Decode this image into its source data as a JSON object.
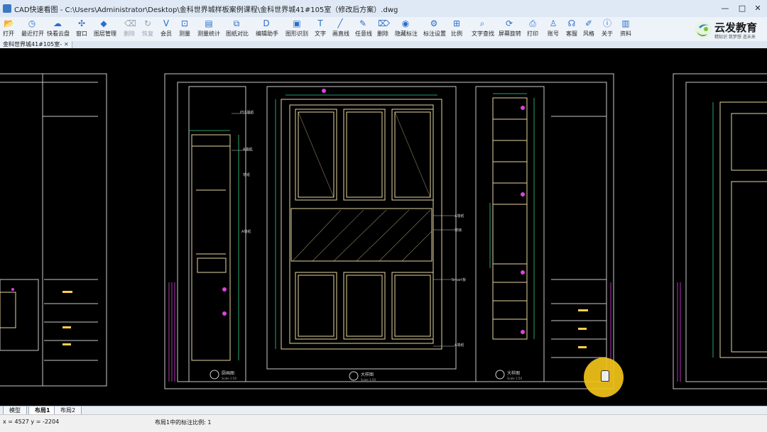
{
  "window": {
    "title": "CAD快速看图 - C:\\Users\\Administrator\\Desktop\\金科世界城样板案例课程\\金科世界城41#105室（修改后方案）.dwg",
    "minimize": "—",
    "maximize": "□",
    "close": "✕"
  },
  "toolbar": {
    "items": [
      {
        "label": "打开",
        "icon": "folder-icon",
        "glyph": "📂"
      },
      {
        "label": "最近打开",
        "icon": "clock-icon",
        "glyph": "◷"
      },
      {
        "label": "快看云盘",
        "icon": "cloud-icon",
        "glyph": "☁"
      },
      {
        "label": "窗口",
        "icon": "window-icon",
        "glyph": "✣"
      },
      {
        "label": "图层管理",
        "icon": "layers-icon",
        "glyph": "◆"
      },
      {
        "label": "删除",
        "icon": "delete-icon",
        "glyph": "⌫",
        "disabled": true
      },
      {
        "label": "恢复",
        "icon": "restore-icon",
        "glyph": "↻",
        "disabled": true
      },
      {
        "label": "会员",
        "icon": "vip-icon",
        "glyph": "V"
      },
      {
        "label": "测量",
        "icon": "ruler-icon",
        "glyph": "⊡"
      },
      {
        "label": "测量统计",
        "icon": "measure-stats-icon",
        "glyph": "▤"
      },
      {
        "label": "图纸对比",
        "icon": "compare-icon",
        "glyph": "⧉"
      },
      {
        "label": "编辑助手",
        "icon": "edit-assistant-icon",
        "glyph": "D"
      },
      {
        "label": "图形识别",
        "icon": "shape-recognition-icon",
        "glyph": "▣"
      },
      {
        "label": "文字",
        "icon": "text-icon",
        "glyph": "T"
      },
      {
        "label": "画直线",
        "icon": "line-icon",
        "glyph": "╱"
      },
      {
        "label": "任意线",
        "icon": "pencil-icon",
        "glyph": "✎"
      },
      {
        "label": "删除",
        "icon": "eraser-icon",
        "glyph": "⌦"
      },
      {
        "label": "隐藏标注",
        "icon": "hide-annotation-icon",
        "glyph": "◉"
      },
      {
        "label": "标注设置",
        "icon": "annotation-settings-icon",
        "glyph": "⚙"
      },
      {
        "label": "比例",
        "icon": "scale-icon",
        "glyph": "⊞"
      },
      {
        "label": "文字查找",
        "icon": "text-search-icon",
        "glyph": "⌕"
      },
      {
        "label": "屏幕旋转",
        "icon": "rotate-screen-icon",
        "glyph": "⟳"
      },
      {
        "label": "打印",
        "icon": "print-icon",
        "glyph": "⎙"
      },
      {
        "label": "账号",
        "icon": "account-icon",
        "glyph": "♙"
      },
      {
        "label": "客服",
        "icon": "headset-icon",
        "glyph": "☊"
      },
      {
        "label": "风格",
        "icon": "style-icon",
        "glyph": "✐"
      },
      {
        "label": "关于",
        "icon": "info-icon",
        "glyph": "ⓘ"
      },
      {
        "label": "资料",
        "icon": "book-icon",
        "glyph": "▥"
      }
    ]
  },
  "logo": {
    "name": "云发教育",
    "slogan": "精知识 筑梦想 造未来"
  },
  "document_tab": {
    "label": "金科世界城41#105室-",
    "close": "✕"
  },
  "drawing": {
    "views": [
      {
        "label": "厨画图",
        "scale": "Scale 1:50"
      },
      {
        "label": "大样图",
        "scale": "Scale 1:50"
      },
      {
        "label": "大样图",
        "scale": "Scale 1:50"
      }
    ],
    "annotations": [
      "P55墙纸",
      "A墙纸",
      "墙纸",
      "A墙纸",
      "玻璃",
      "Smart板",
      "A墙纸",
      "A墙纸"
    ],
    "colors": {
      "frame": "#c8c8c8",
      "cabinet": "#e6d6a0",
      "dimension": "#2fd08a",
      "accent": "#e040e0",
      "annotation": "#ffd04a"
    }
  },
  "layout_tabs": [
    {
      "label": "模型",
      "active": false
    },
    {
      "label": "布局1",
      "active": true
    },
    {
      "label": "布局2",
      "active": false
    }
  ],
  "status": {
    "coordinates": "x = 4527  y = -2204",
    "message": "布局1中的标注比例: 1"
  }
}
